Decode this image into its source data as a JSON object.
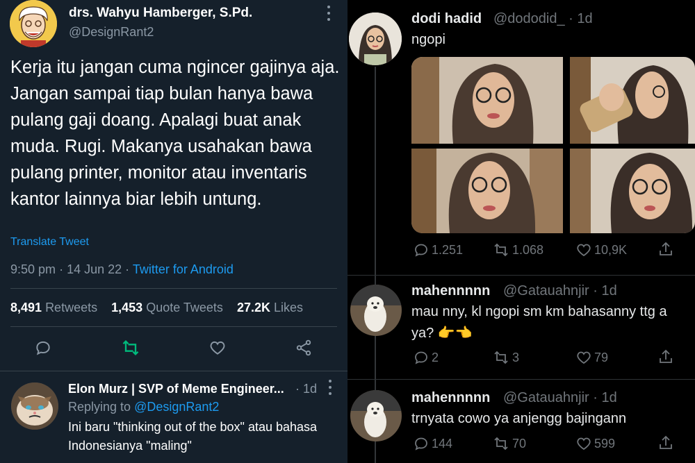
{
  "left_tweet": {
    "author_name": "drs. Wahyu Hamberger, S.Pd.",
    "author_handle": "@DesignRant2",
    "text": "Kerja itu jangan cuma ngincer gajinya aja. Jangan sampai tiap bulan hanya bawa pulang gaji doang. Apalagi buat anak muda. Rugi. Makanya usahakan bawa pulang printer, monitor atau inventaris kantor lainnya biar lebih untung.",
    "translate_label": "Translate Tweet",
    "time": "9:50 pm",
    "date": "14 Jun 22",
    "source": "Twitter for Android",
    "retweets_count": "8,491",
    "retweets_label": "Retweets",
    "quotes_count": "1,453",
    "quotes_label": "Quote Tweets",
    "likes_count": "27.2K",
    "likes_label": "Likes",
    "icons": [
      "reply-icon",
      "retweet-icon",
      "like-icon",
      "share-icon"
    ],
    "retweet_color": "#00ba7c"
  },
  "left_reply": {
    "author_name": "Elon Murz | SVP of Meme Engineer...",
    "time": "· 1d",
    "replying_prefix": "Replying to",
    "replying_handle": "@DesignRant2",
    "text": "Ini baru \"thinking out of the box\" atau bahasa Indonesianya \"maling\""
  },
  "right_tweet": {
    "author_name": "dodi hadid",
    "author_handle": "@dododid_",
    "time": "· 1d",
    "text": "ngopi",
    "replies": "1.251",
    "retweets": "1.068",
    "likes": "10,9K"
  },
  "right_reply_1": {
    "author_name": "mahennnnn",
    "author_handle": "@Gatauahnjir",
    "time": "· 1d",
    "text_line1": "mau nny, kl ngopi sm km bahasanny ttg a",
    "text_line2": "ya? 👉👈",
    "replies": "2",
    "retweets": "3",
    "likes": "79"
  },
  "right_reply_2": {
    "author_name": "mahennnnn",
    "author_handle": "@Gatauahnjir",
    "time": "· 1d",
    "text": "trnyata cowo ya anjengg bajingann",
    "replies": "144",
    "retweets": "70",
    "likes": "599"
  },
  "colors": {
    "left_bg": "#15202b",
    "right_bg": "#000000",
    "link_blue": "#1d9bf0",
    "muted_left": "#8b98a5",
    "muted_right": "#71767b"
  }
}
